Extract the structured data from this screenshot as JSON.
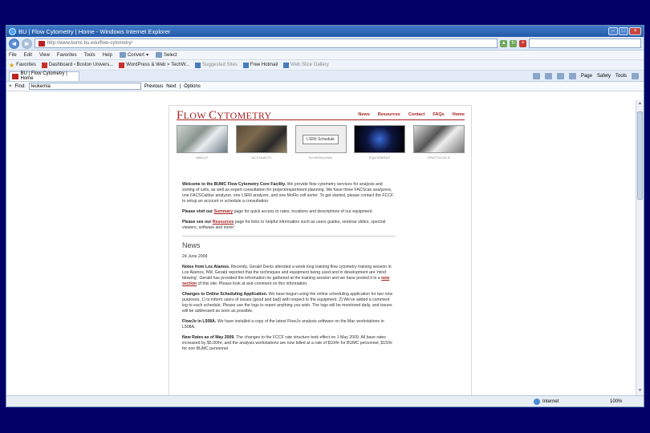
{
  "window": {
    "title": "BU | Flow Cytometry | Home - Windows Internet Explorer"
  },
  "address": {
    "url": "http://www.bumc.bu.edu/flow-cytometry/",
    "search_placeholder": ""
  },
  "menu": {
    "items": [
      "File",
      "Edit",
      "View",
      "Favorites",
      "Tools",
      "Help"
    ],
    "tools": [
      "Convert",
      "Select"
    ]
  },
  "favorites": {
    "label": "Favorites",
    "items": [
      "Dashboard ‹ Boston Univers...",
      "WordPress & Web > TechW...",
      "Suggested Sites",
      "Free Hotmail",
      "Web Slice Gallery"
    ]
  },
  "tab": {
    "label": "BU | Flow Cytometry | Home"
  },
  "commands": [
    "Page",
    "Safety",
    "Tools"
  ],
  "find": {
    "label": "Find:",
    "value": "leukemia",
    "prev": "Previous",
    "next": "Next",
    "options": "Options"
  },
  "site": {
    "logo_a": "F",
    "logo_b": "LOW ",
    "logo_c": "C",
    "logo_d": "YTOMETRY",
    "nav": [
      "News",
      "Resources",
      "Contact",
      "FAQs",
      "Home"
    ],
    "photos": [
      {
        "caption": "ABOUT"
      },
      {
        "caption": "ACCOUNTS"
      },
      {
        "caption": "SCHEDULING",
        "inner": "LSRII Schedule"
      },
      {
        "caption": "EQUIPMENT"
      },
      {
        "caption": "PROTOCOLS"
      }
    ],
    "welcome_bold": "Welcome to the BUMC Flow Cytometry Core Facility.",
    "welcome_text": " We provide flow cytometry services for analysis and sorting of cells, as well as expert consultation for project/experiment planning. We have three FACScan analyzers, one FACSCalibur analyzer, one LSRII analyzer, and one MoFlo cell sorter. To get started, please contact the FCCF to setup an account or schedule a consultation.",
    "summary_a": "Please visit our ",
    "summary_link": "Summary",
    "summary_b": " page for quick access to rates, locations and descriptions of our equipment.",
    "resources_a": "Please see our ",
    "resources_link": "Resources",
    "resources_b": " page for links to helpful information such as users guides, seminar slides, spectral viewers, software and more!",
    "news_title": "News",
    "news_date": "24 June 2009",
    "n1_bold": "Notes from Los Alamos.",
    "n1_text": " Recently, Gerald Denis attended a week long training flow cytometry training session in Los Alamos, NM. Gerald reported that the techniques and equipment being used and in development are 'mind blowing'. Gerald has provided the information he gathered at the training session and we have posted it in a ",
    "n1_link": "new section",
    "n1_tail": " of this site. Please look at and comment on this information.",
    "n2_bold": "Changes to Online Scheduling Application.",
    "n2_text": " We have begun using the online scheduling application for two new purposes, 1) to inform users of issues (good and bad) with respect to the equipment. 2) We've added a comment log to each schedule. Please use the logs to report anything you wish. The logs will be monitored daily, and issues will be addressed as soon as possible.",
    "n3_bold": "FlowJo in L508A.",
    "n3_text": " We have installed a copy of the latest FlowJo analysis software on the Mac workstations in L508A.",
    "n4_bold": "New Rates as of May 2009.",
    "n4_text": " The changes to the FCCF rate structure took effect on 1 May 2009. All base rates increased by $5.00/hr, and the analysis workstations are now billed at a rate of $10/hr for BUMC personnel, $15/hr for non BUMC personnel."
  },
  "status": {
    "zone": "Internet",
    "zoom": "100%"
  }
}
